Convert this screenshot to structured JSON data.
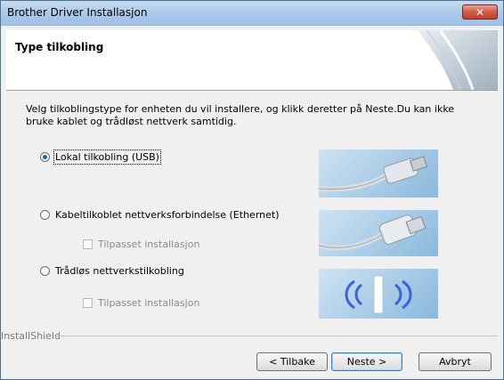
{
  "window": {
    "title": "Brother Driver Installasjon",
    "close_glyph": "✕"
  },
  "header": {
    "title": "Type tilkobling"
  },
  "instructions": "Velg tilkoblingstype for enheten du vil installere, og klikk deretter på Neste.Du kan ikke bruke kablet og trådløst nettverk samtidig.",
  "options": [
    {
      "label": "Lokal tilkobling (USB)",
      "selected": true,
      "image": "usb-cable-icon"
    },
    {
      "label": "Kabeltilkoblet nettverksforbindelse (Ethernet)",
      "selected": false,
      "checkbox_label": "Tilpasset installasjon",
      "image": "ethernet-cable-icon"
    },
    {
      "label": "Trådløs nettverkstilkobling",
      "selected": false,
      "checkbox_label": "Tilpasset installasjon",
      "image": "wireless-router-icon"
    }
  ],
  "footer": {
    "brand": "InstallShield",
    "back_label": "< Tilbake",
    "next_label": "Neste >",
    "cancel_label": "Avbryt"
  }
}
